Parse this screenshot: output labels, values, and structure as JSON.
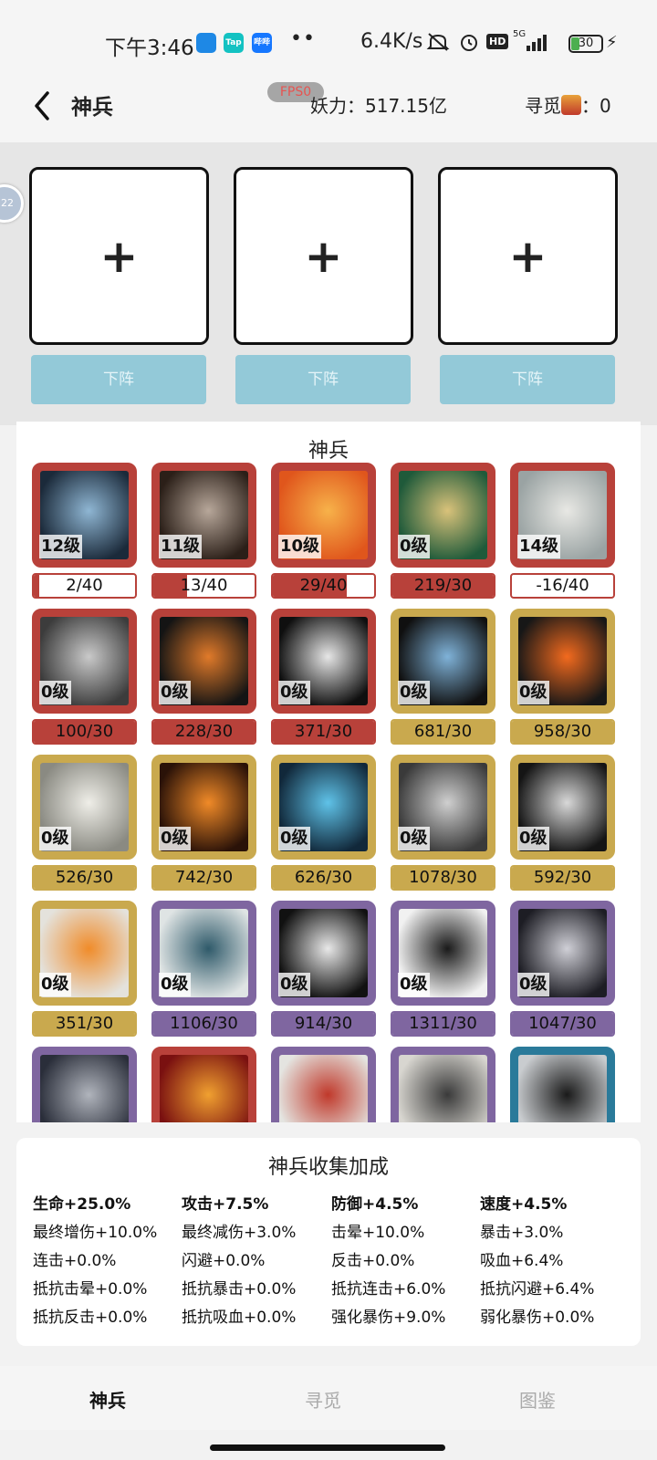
{
  "status_bar": {
    "time": "下午3:46",
    "app_icons": [
      {
        "name": "app-icon-blue",
        "label": "",
        "color": "#1e88e5"
      },
      {
        "name": "app-icon-taptap",
        "label": "Tap",
        "color": "#13c2c2"
      },
      {
        "name": "app-icon-blue2",
        "label": "哔哔",
        "color": "#1677ff"
      }
    ],
    "dots": "••",
    "speed": "6.4K/s",
    "network": "5G",
    "hd": "HD",
    "battery": "30"
  },
  "header": {
    "back_icon": "chevron-left-icon",
    "title": "神兵",
    "fps_badge": "FPS0",
    "power_label": "妖力：517.15亿",
    "seek_label": "寻觅",
    "seek_icon": "slot-machine-icon",
    "seek_count": "：0"
  },
  "formation": {
    "side_badge": "22",
    "slots": [
      {
        "plus": "+",
        "button": "下阵"
      },
      {
        "plus": "+",
        "button": "下阵"
      },
      {
        "plus": "+",
        "button": "下阵"
      }
    ]
  },
  "weapons": {
    "title": "神兵",
    "colors": {
      "red": "#b8413a",
      "gold": "#c9a94e",
      "purple": "#7f66a0",
      "blue": "#2a7a9a"
    },
    "items": [
      {
        "level": "12级",
        "progress": "2/40",
        "rarity": "red",
        "fill": 0.05,
        "art": [
          "#1b2a3a",
          "#8fb6d3"
        ]
      },
      {
        "level": "11级",
        "progress": "13/40",
        "rarity": "red",
        "fill": 0.33,
        "art": [
          "#2b1f18",
          "#b7a79a"
        ]
      },
      {
        "level": "10级",
        "progress": "29/40",
        "rarity": "red",
        "fill": 0.73,
        "art": [
          "#e0561c",
          "#f7b24a"
        ]
      },
      {
        "level": "0级",
        "progress": "219/30",
        "rarity": "red",
        "fill": 1,
        "art": [
          "#1f5a3a",
          "#d9c27a"
        ]
      },
      {
        "level": "14级",
        "progress": "-16/40",
        "rarity": "red",
        "fill": 0,
        "art": [
          "#9aa3a3",
          "#e8e8e4"
        ]
      },
      {
        "level": "0级",
        "progress": "100/30",
        "rarity": "red",
        "fill": 1,
        "art": [
          "#3c3c3c",
          "#c9c9c9"
        ]
      },
      {
        "level": "0级",
        "progress": "228/30",
        "rarity": "red",
        "fill": 1,
        "art": [
          "#141414",
          "#e07a2a"
        ]
      },
      {
        "level": "0级",
        "progress": "371/30",
        "rarity": "red",
        "fill": 1,
        "art": [
          "#0f0f0f",
          "#e6e6e6"
        ]
      },
      {
        "level": "0级",
        "progress": "681/30",
        "rarity": "gold",
        "fill": 1,
        "art": [
          "#101010",
          "#7fb2d8"
        ]
      },
      {
        "level": "0级",
        "progress": "958/30",
        "rarity": "gold",
        "fill": 1,
        "art": [
          "#171717",
          "#f26a1e"
        ]
      },
      {
        "level": "0级",
        "progress": "526/30",
        "rarity": "gold",
        "fill": 1,
        "art": [
          "#8a8a82",
          "#efeee8"
        ]
      },
      {
        "level": "0级",
        "progress": "742/30",
        "rarity": "gold",
        "fill": 1,
        "art": [
          "#2a1208",
          "#f08a28"
        ]
      },
      {
        "level": "0级",
        "progress": "626/30",
        "rarity": "gold",
        "fill": 1,
        "art": [
          "#11283a",
          "#5fc2e8"
        ]
      },
      {
        "level": "0级",
        "progress": "1078/30",
        "rarity": "gold",
        "fill": 1,
        "art": [
          "#3a3a3a",
          "#cfcfcf"
        ]
      },
      {
        "level": "0级",
        "progress": "592/30",
        "rarity": "gold",
        "fill": 1,
        "art": [
          "#151515",
          "#d8d8d8"
        ]
      },
      {
        "level": "0级",
        "progress": "351/30",
        "rarity": "gold",
        "fill": 1,
        "art": [
          "#e4e2dc",
          "#f08c2a"
        ]
      },
      {
        "level": "0级",
        "progress": "1106/30",
        "rarity": "purple",
        "fill": 1,
        "art": [
          "#dfe4e4",
          "#2f5a6a"
        ]
      },
      {
        "level": "0级",
        "progress": "914/30",
        "rarity": "purple",
        "fill": 1,
        "art": [
          "#111111",
          "#e8e8e8"
        ]
      },
      {
        "level": "0级",
        "progress": "1311/30",
        "rarity": "purple",
        "fill": 1,
        "art": [
          "#f1f1f1",
          "#1a1a1a"
        ]
      },
      {
        "level": "0级",
        "progress": "1047/30",
        "rarity": "purple",
        "fill": 1,
        "art": [
          "#1d1d24",
          "#cfcfd6"
        ]
      },
      {
        "level": "",
        "progress": "",
        "rarity": "purple",
        "fill": 0,
        "art": [
          "#2a2e3a",
          "#b0b4bc"
        ]
      },
      {
        "level": "",
        "progress": "",
        "rarity": "red",
        "fill": 0,
        "art": [
          "#7a1010",
          "#f0a030"
        ]
      },
      {
        "level": "",
        "progress": "",
        "rarity": "purple",
        "fill": 0,
        "art": [
          "#e4e4e0",
          "#c0392b"
        ]
      },
      {
        "level": "",
        "progress": "",
        "rarity": "purple",
        "fill": 0,
        "art": [
          "#d8d6d0",
          "#3a3a3a"
        ]
      },
      {
        "level": "",
        "progress": "",
        "rarity": "blue",
        "fill": 0,
        "art": [
          "#c9cccf",
          "#1a1a1a"
        ]
      }
    ]
  },
  "bonus": {
    "title": "神兵收集加成",
    "rows": [
      [
        "生命+25.0%",
        "攻击+7.5%",
        "防御+4.5%",
        "速度+4.5%"
      ],
      [
        "最终增伤+10.0%",
        "最终减伤+3.0%",
        "击晕+10.0%",
        "暴击+3.0%"
      ],
      [
        "连击+0.0%",
        "闪避+0.0%",
        "反击+0.0%",
        "吸血+6.4%"
      ],
      [
        "抵抗击晕+0.0%",
        "抵抗暴击+0.0%",
        "抵抗连击+6.0%",
        "抵抗闪避+6.4%"
      ],
      [
        "抵抗反击+0.0%",
        "抵抗吸血+0.0%",
        "强化暴伤+9.0%",
        "弱化暴伤+0.0%"
      ]
    ]
  },
  "nav": {
    "tabs": [
      {
        "label": "神兵",
        "active": true
      },
      {
        "label": "寻觅",
        "active": false
      },
      {
        "label": "图鉴",
        "active": false
      }
    ]
  }
}
